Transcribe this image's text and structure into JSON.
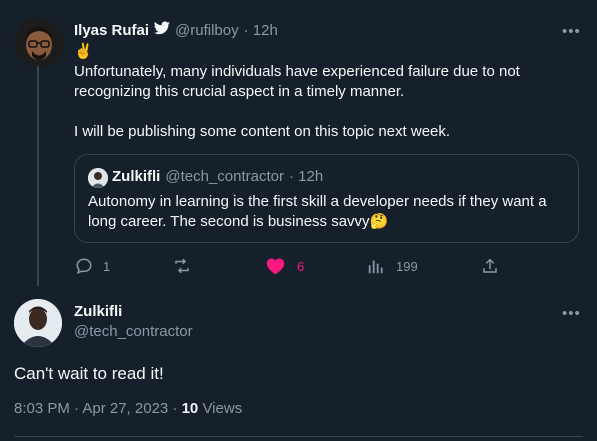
{
  "tweet": {
    "author_name": "Ilyas Rufai",
    "verified_icon": "bird-icon",
    "handle": "@rufilboy",
    "time": "· 12h",
    "emoji": "✌️",
    "line1": "Unfortunately, many individuals have experienced failure due to not",
    "line2": "recognizing this crucial aspect in a timely manner.",
    "line3": "I will be publishing some content on this topic next week.",
    "quote": {
      "author_name": "Zulkifli",
      "handle": "@tech_contractor",
      "time": "· 12h",
      "line1": "Autonomy in learning is the first skill a developer needs if they want a",
      "line2": "long career. The second is business savvy",
      "emoji": "🤔"
    },
    "actions": {
      "reply_count": "1",
      "retweet_count": "",
      "like_count": "6",
      "views_count": "199"
    },
    "like_color": "#f91880"
  },
  "reply": {
    "author_name": "Zulkifli",
    "handle": "@tech_contractor",
    "text": "Can't wait to read it!",
    "timestamp": "8:03 PM · Apr 27, 2023 · ",
    "views_number": "10",
    "views_label": "Views"
  },
  "more_label": "•••"
}
